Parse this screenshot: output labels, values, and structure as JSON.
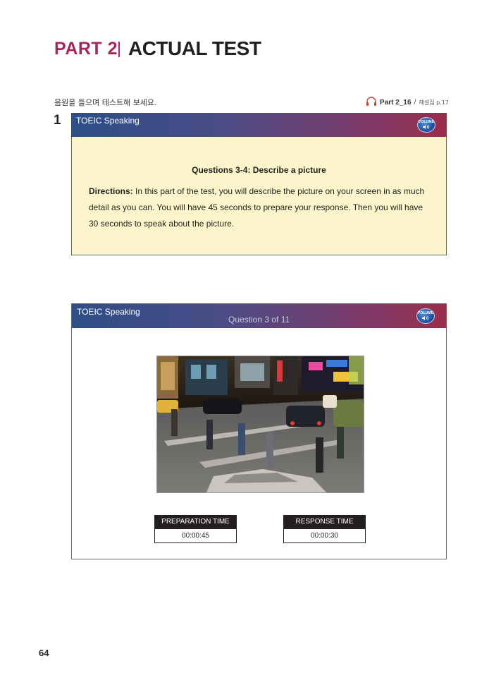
{
  "header": {
    "part_label": "PART 2",
    "section_title": "ACTUAL TEST",
    "accent_color": "#a3285e"
  },
  "instruction": "음원을 들으며 테스트해 보세요.",
  "audio_ref": {
    "icon": "headphones-icon",
    "track": "Part 2_16",
    "separator": "/",
    "explanation_ref": "해설집 p.17"
  },
  "question_number": "1",
  "panel1": {
    "app_title": "TOEIC Speaking",
    "volume_label": "VOLUME",
    "directions_heading": "Questions 3-4: Describe a picture",
    "directions_label": "Directions:",
    "directions_text": "In this part of the test, you will describe the picture on your screen in as much detail as you can. You will have 45 seconds to prepare your response. Then you will have 30 seconds to speak about the picture."
  },
  "panel2": {
    "app_title": "TOEIC Speaking",
    "question_counter": "Question 3 of 11",
    "volume_label": "VOLUME",
    "photo_icon": "city-street-photo",
    "preparation_label": "PREPARATION TIME",
    "preparation_value": "00:00:45",
    "response_label": "RESPONSE TIME",
    "response_value": "00:00:30"
  },
  "page_number": "64",
  "colors": {
    "header_gradient_start": "#2d4e87",
    "header_gradient_end": "#9a2d4c",
    "directions_bg": "#fcf5cc"
  }
}
